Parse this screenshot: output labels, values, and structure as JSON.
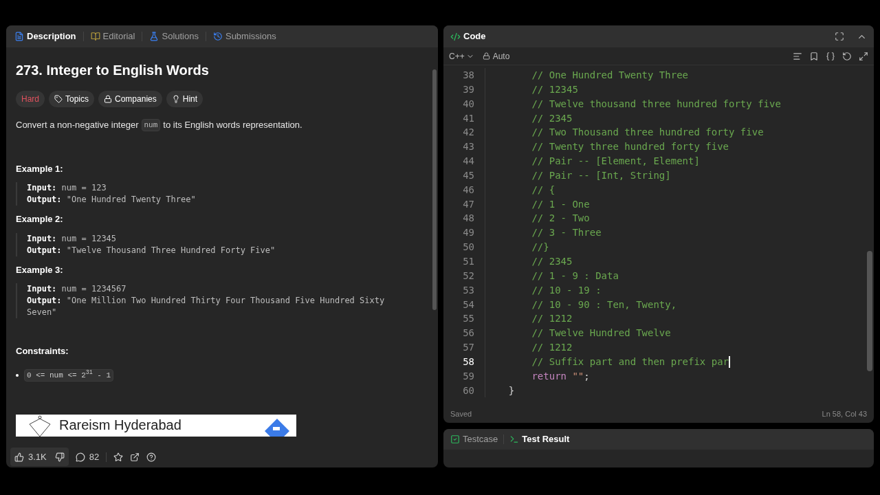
{
  "left_tabs": [
    {
      "label": "Description",
      "selected": true
    },
    {
      "label": "Editorial",
      "selected": false
    },
    {
      "label": "Solutions",
      "selected": false
    },
    {
      "label": "Submissions",
      "selected": false
    }
  ],
  "problem": {
    "title": "273. Integer to English Words",
    "tags": [
      {
        "kind": "difficulty",
        "label": "Hard"
      },
      {
        "kind": "topics",
        "label": "Topics"
      },
      {
        "kind": "companies",
        "label": "Companies"
      },
      {
        "kind": "hint",
        "label": "Hint"
      }
    ],
    "description": [
      {
        "kind": "text",
        "text": "Convert a non-negative integer"
      },
      {
        "kind": "code",
        "text": "num"
      },
      {
        "kind": "text",
        "text": "to its English words representation."
      }
    ],
    "examples": [
      {
        "heading": "Example 1:",
        "input_label": "Input:",
        "input": "num = 123",
        "output_label": "Output:",
        "output": "\"One Hundred Twenty Three\""
      },
      {
        "heading": "Example 2:",
        "input_label": "Input:",
        "input": "num = 12345",
        "output_label": "Output:",
        "output": "\"Twelve Thousand Three Hundred Forty Five\""
      },
      {
        "heading": "Example 3:",
        "input_label": "Input:",
        "input": "num = 1234567",
        "output_label": "Output:",
        "output": "\"One Million Two Hundred Thirty Four Thousand Five Hundred Sixty Seven\""
      }
    ],
    "constraints_heading": "Constraints:",
    "constraints": [
      "0 <= num <= 2$^{31}$ - 1"
    ],
    "ad": {
      "title": "Rareism Hyderabad"
    }
  },
  "footer": {
    "likes": "3.1K",
    "comments": "82"
  },
  "editor": {
    "title": "Code",
    "language": "C++",
    "mode": "Auto",
    "lines": [
      {
        "number": "38",
        "cursor": false,
        "tokens": [
          {
            "kind": "comment",
            "text": "        // One Hundred Twenty Three"
          }
        ]
      },
      {
        "number": "39",
        "cursor": false,
        "tokens": [
          {
            "kind": "comment",
            "text": "        // 12345"
          }
        ]
      },
      {
        "number": "40",
        "cursor": false,
        "tokens": [
          {
            "kind": "comment",
            "text": "        // Twelve thousand three hundred forty five"
          }
        ]
      },
      {
        "number": "41",
        "cursor": false,
        "tokens": [
          {
            "kind": "comment",
            "text": "        // 2345"
          }
        ]
      },
      {
        "number": "42",
        "cursor": false,
        "tokens": [
          {
            "kind": "comment",
            "text": "        // Two Thousand three hundred forty five"
          }
        ]
      },
      {
        "number": "43",
        "cursor": false,
        "tokens": [
          {
            "kind": "comment",
            "text": "        // Twenty three hundred forty five"
          }
        ]
      },
      {
        "number": "44",
        "cursor": false,
        "tokens": [
          {
            "kind": "comment",
            "text": "        // Pair -- [Element, Element]"
          }
        ]
      },
      {
        "number": "45",
        "cursor": false,
        "tokens": [
          {
            "kind": "comment",
            "text": "        // Pair -- [Int, String]"
          }
        ]
      },
      {
        "number": "46",
        "cursor": false,
        "tokens": [
          {
            "kind": "comment",
            "text": "        // {"
          }
        ]
      },
      {
        "number": "47",
        "cursor": false,
        "tokens": [
          {
            "kind": "comment",
            "text": "        // 1 - One"
          }
        ]
      },
      {
        "number": "48",
        "cursor": false,
        "tokens": [
          {
            "kind": "comment",
            "text": "        // 2 - Two"
          }
        ]
      },
      {
        "number": "49",
        "cursor": false,
        "tokens": [
          {
            "kind": "comment",
            "text": "        // 3 - Three"
          }
        ]
      },
      {
        "number": "50",
        "cursor": false,
        "tokens": [
          {
            "kind": "comment",
            "text": "        //}"
          }
        ]
      },
      {
        "number": "51",
        "cursor": false,
        "tokens": [
          {
            "kind": "comment",
            "text": "        // 2345"
          }
        ]
      },
      {
        "number": "52",
        "cursor": false,
        "tokens": [
          {
            "kind": "comment",
            "text": "        // 1 - 9 : Data"
          }
        ]
      },
      {
        "number": "53",
        "cursor": false,
        "tokens": [
          {
            "kind": "comment",
            "text": "        // 10 - 19 :"
          }
        ]
      },
      {
        "number": "54",
        "cursor": false,
        "tokens": [
          {
            "kind": "comment",
            "text": "        // 10 - 90 : Ten, Twenty,"
          }
        ]
      },
      {
        "number": "55",
        "cursor": false,
        "tokens": [
          {
            "kind": "comment",
            "text": "        // 1212"
          }
        ]
      },
      {
        "number": "56",
        "cursor": false,
        "tokens": [
          {
            "kind": "comment",
            "text": "        // Twelve Hundred Twelve"
          }
        ]
      },
      {
        "number": "57",
        "cursor": false,
        "tokens": [
          {
            "kind": "comment",
            "text": "        // 1212"
          }
        ]
      },
      {
        "number": "58",
        "cursor": true,
        "tokens": [
          {
            "kind": "comment",
            "text": "        // Suffix part and then prefix par"
          }
        ]
      },
      {
        "number": "59",
        "cursor": false,
        "tokens": [
          {
            "kind": "keyword",
            "text": "        return"
          },
          {
            "kind": "string",
            "text": " \"\""
          },
          {
            "kind": "plain",
            "text": ";"
          }
        ]
      },
      {
        "number": "60",
        "cursor": false,
        "tokens": [
          {
            "kind": "bracket",
            "text": "    }"
          }
        ]
      }
    ],
    "status": "Saved",
    "position": "Ln 58, Col 43"
  },
  "bottom_tabs": [
    {
      "kind": "testcase",
      "label": "Testcase",
      "selected": false
    },
    {
      "kind": "result",
      "label": "Test Result",
      "selected": true
    }
  ]
}
